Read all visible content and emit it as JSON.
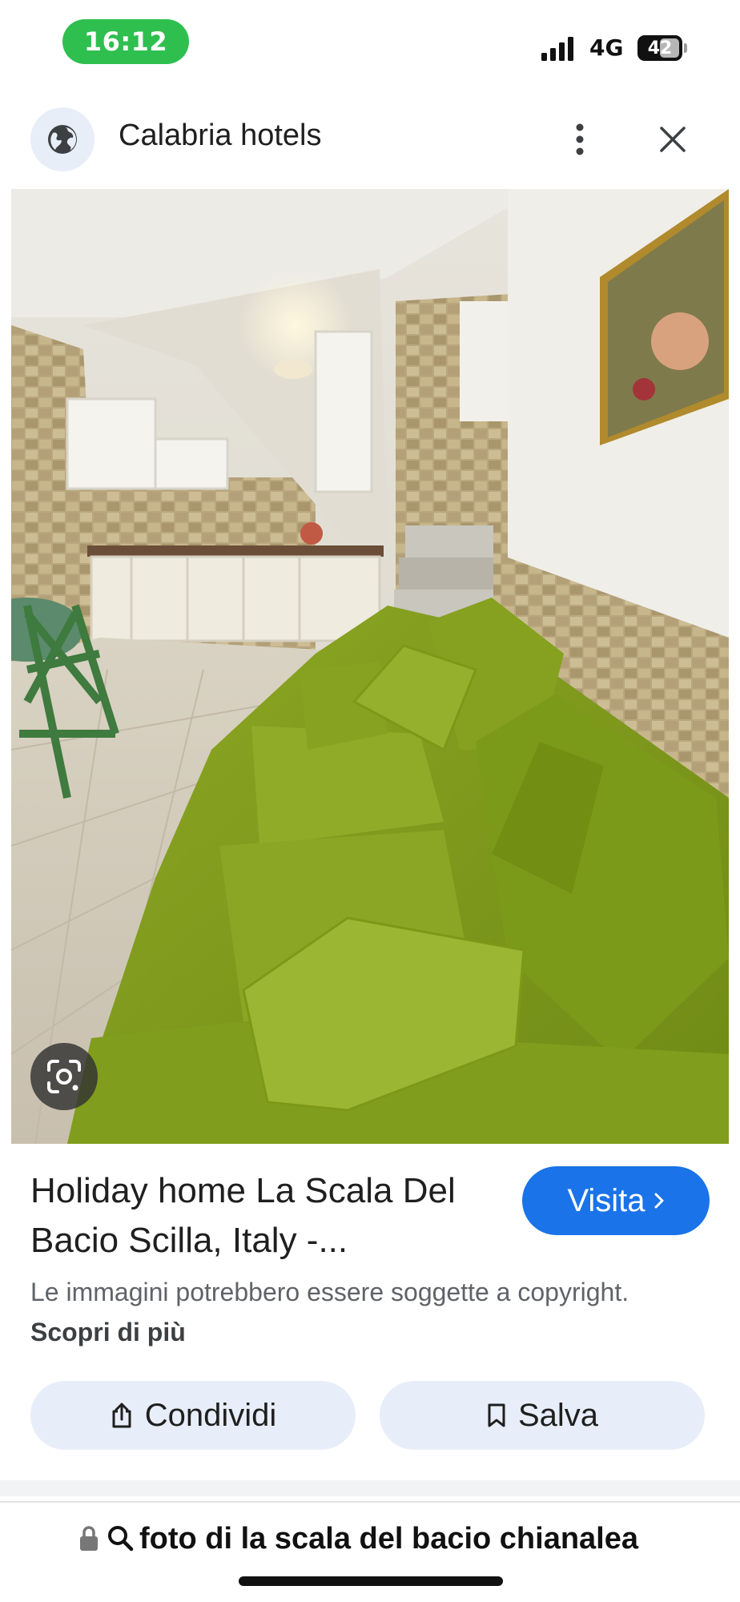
{
  "status_bar": {
    "time": "16:12",
    "network": "4G",
    "battery": "42"
  },
  "header": {
    "title": "Calabria hotels",
    "icons": [
      "globe-icon",
      "more-vert-icon",
      "close-icon"
    ]
  },
  "image": {
    "lens_icon": "google-lens-icon"
  },
  "result": {
    "title": "Holiday home La Scala Del Bacio Scilla, Italy -...",
    "visit_label": "Visita",
    "copyright_text": "Le immagini potrebbero essere soggette a copyright.",
    "learn_more_label": "Scopri di più",
    "share_label": "Condividi",
    "save_label": "Salva"
  },
  "address_bar": {
    "query": "foto di la scala del bacio chianalea"
  },
  "colors": {
    "accent": "#1a73e8",
    "time_pill": "#2fbf4f",
    "chip_background": "#e8eef9"
  }
}
